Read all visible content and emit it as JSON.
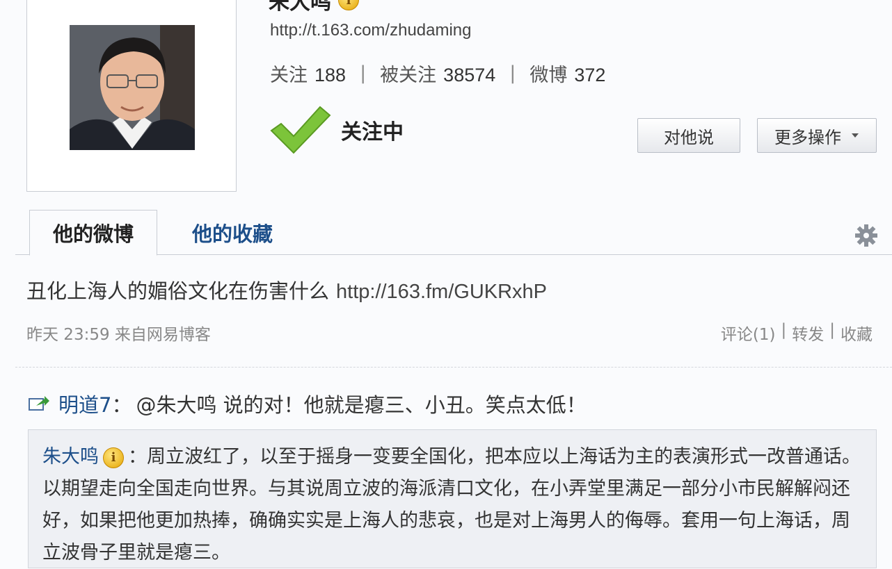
{
  "profile": {
    "name": "朱大鸣",
    "url": "http://t.163.com/zhudaming",
    "stats": [
      {
        "label": "关注",
        "value": "188"
      },
      {
        "label": "被关注",
        "value": "38574"
      },
      {
        "label": "微博",
        "value": "372"
      }
    ],
    "follow_state": "关注中",
    "badge_char": "i"
  },
  "actions": {
    "talk_label": "对他说",
    "more_label": "更多操作"
  },
  "tabs": [
    {
      "label": "他的微博"
    },
    {
      "label": "他的收藏"
    }
  ],
  "post": {
    "text": "丑化上海人的媚俗文化在伤害什么",
    "link": "http://163.fm/GUKRxhP",
    "meta": "昨天 23:59 来自网易博客",
    "comment_label": "评论(1)",
    "forward_label": "转发",
    "favorite_label": "收藏",
    "separator": "|"
  },
  "repost": {
    "author": "明道7",
    "colon": "：",
    "message": "@朱大鸣 说的对！他就是瘪三、小丑。笑点太低！"
  },
  "quoted": {
    "author": "朱大鸣",
    "text": "：周立波红了，以至于摇身一变要全国化，把本应以上海话为主的表演形式一改普通话。以期望走向全国走向世界。与其说周立波的海派清口文化，在小弄堂里满足一部分小市民解解闷还好，如果把他更加热捧，确确实实是上海人的悲哀，也是对上海男人的侮辱。套用一句上海话，周立波骨子里就是瘪三。"
  },
  "colors": {
    "link_blue": "#1d4f8a",
    "check_green": "#7cc43a",
    "badge_gold": "#e4a400"
  }
}
